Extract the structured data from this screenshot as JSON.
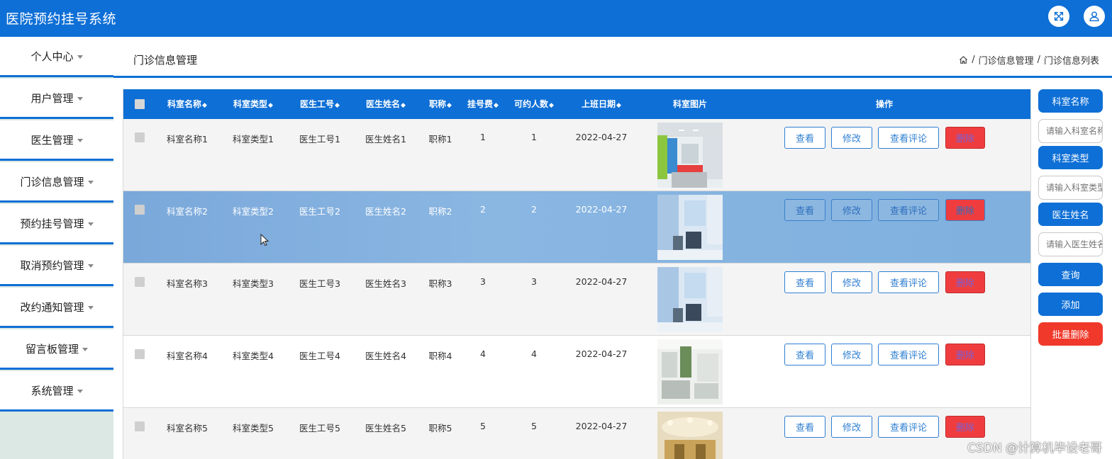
{
  "app": {
    "title": "医院预约挂号系统"
  },
  "topbar": {
    "icons": [
      "fullscreen-icon",
      "user-icon"
    ]
  },
  "sidebar": {
    "items": [
      {
        "label": "个人中心"
      },
      {
        "label": "用户管理"
      },
      {
        "label": "医生管理"
      },
      {
        "label": "门诊信息管理"
      },
      {
        "label": "预约挂号管理"
      },
      {
        "label": "取消预约管理"
      },
      {
        "label": "改约通知管理"
      },
      {
        "label": "留言板管理"
      },
      {
        "label": "系统管理"
      }
    ]
  },
  "header": {
    "title": "门诊信息管理",
    "breadcrumb": [
      "门诊信息管理",
      "门诊信息列表"
    ],
    "breadcrumb_sep": "/"
  },
  "table": {
    "columns": [
      "科室名称",
      "科室类型",
      "医生工号",
      "医生姓名",
      "职称",
      "挂号费",
      "可约人数",
      "上班日期",
      "科室图片",
      "操作"
    ],
    "sortable_mark": "◆",
    "rows": [
      {
        "name": "科室名称1",
        "type": "科室类型1",
        "doc_id": "医生工号1",
        "doc_name": "医生姓名1",
        "title": "职称1",
        "fee": "1",
        "quota": "1",
        "date": "2022-04-27"
      },
      {
        "name": "科室名称2",
        "type": "科室类型2",
        "doc_id": "医生工号2",
        "doc_name": "医生姓名2",
        "title": "职称2",
        "fee": "2",
        "quota": "2",
        "date": "2022-04-27"
      },
      {
        "name": "科室名称3",
        "type": "科室类型3",
        "doc_id": "医生工号3",
        "doc_name": "医生姓名3",
        "title": "职称3",
        "fee": "3",
        "quota": "3",
        "date": "2022-04-27"
      },
      {
        "name": "科室名称4",
        "type": "科室类型4",
        "doc_id": "医生工号4",
        "doc_name": "医生姓名4",
        "title": "职称4",
        "fee": "4",
        "quota": "4",
        "date": "2022-04-27"
      },
      {
        "name": "科室名称5",
        "type": "科室类型5",
        "doc_id": "医生工号5",
        "doc_name": "医生姓名5",
        "title": "职称5",
        "fee": "5",
        "quota": "5",
        "date": "2022-04-27"
      }
    ],
    "actions": {
      "view": "查看",
      "edit": "修改",
      "view_comments": "查看评论",
      "delete": "删除"
    }
  },
  "search_panel": {
    "field1_label": "科室名称",
    "field1_placeholder": "请输入科室名称",
    "field2_label": "科室类型",
    "field2_placeholder": "请输入科室类型",
    "field3_label": "医生姓名",
    "field3_placeholder": "请输入医生姓名",
    "query": "查询",
    "add": "添加",
    "batch_delete": "批量删除"
  },
  "watermark": "CSDN @计算机毕设老哥",
  "colors": {
    "primary": "#0e6fd6",
    "danger": "#ef3d3f",
    "highlight_row": "#82b0de"
  }
}
